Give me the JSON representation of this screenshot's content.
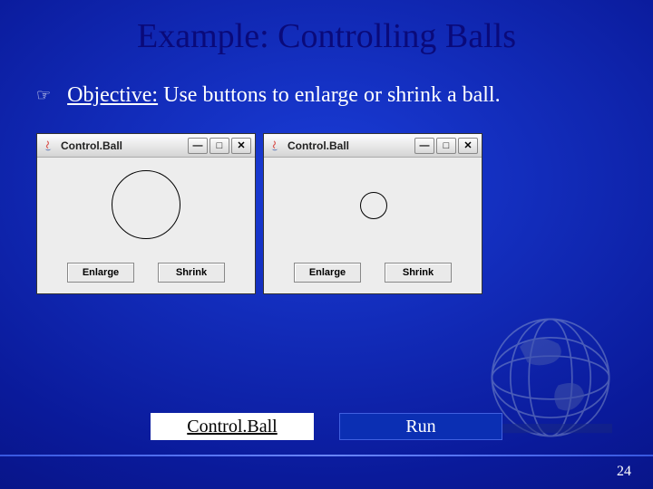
{
  "title": "Example: Controlling Balls",
  "bullet": {
    "label": "Objective:",
    "text": " Use buttons to enlarge or shrink a ball."
  },
  "windows": [
    {
      "title": "Control.Ball",
      "min": "—",
      "max": "□",
      "close": "✕",
      "enlarge": "Enlarge",
      "shrink": "Shrink",
      "circle": "large"
    },
    {
      "title": "Control.Ball",
      "min": "—",
      "max": "□",
      "close": "✕",
      "enlarge": "Enlarge",
      "shrink": "Shrink",
      "circle": "small"
    }
  ],
  "links": {
    "code": "Control.Ball",
    "run": "Run"
  },
  "page": "24"
}
